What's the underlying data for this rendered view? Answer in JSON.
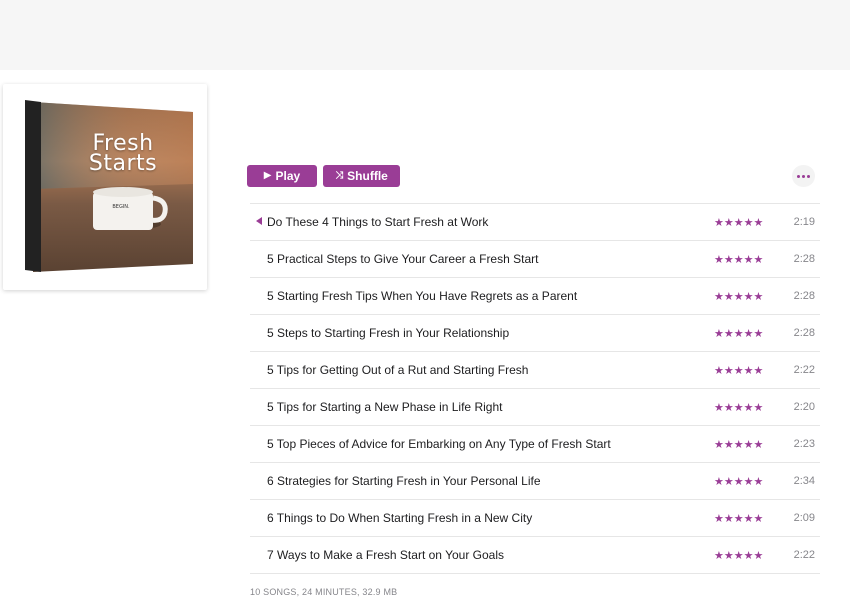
{
  "album": {
    "title": "Fresh\nStarts",
    "mug_text": "BEGIN.",
    "accent": "#9a3d96"
  },
  "controls": {
    "play_label": "Play",
    "play_icon": "play-icon",
    "shuffle_label": "Shuffle",
    "shuffle_icon": "shuffle-icon",
    "more_icon": "ellipsis-icon"
  },
  "tracks": [
    {
      "title": "Do These 4 Things to Start Fresh at Work",
      "rating": "★★★★★",
      "duration": "2:19",
      "now_playing": true
    },
    {
      "title": "5 Practical Steps to Give Your Career a Fresh Start",
      "rating": "★★★★★",
      "duration": "2:28"
    },
    {
      "title": "5 Starting Fresh Tips When You Have Regrets as a Parent",
      "rating": "★★★★★",
      "duration": "2:28"
    },
    {
      "title": "5 Steps to Starting Fresh in Your Relationship",
      "rating": "★★★★★",
      "duration": "2:28"
    },
    {
      "title": "5 Tips for Getting Out of a Rut and Starting Fresh",
      "rating": "★★★★★",
      "duration": "2:22"
    },
    {
      "title": "5 Tips for Starting a New Phase in Life Right",
      "rating": "★★★★★",
      "duration": "2:20"
    },
    {
      "title": "5 Top Pieces of Advice for Embarking on Any Type of Fresh Start",
      "rating": "★★★★★",
      "duration": "2:23"
    },
    {
      "title": "6 Strategies for Starting Fresh in Your Personal Life",
      "rating": "★★★★★",
      "duration": "2:34"
    },
    {
      "title": "6 Things to Do When Starting Fresh in a New City",
      "rating": "★★★★★",
      "duration": "2:09"
    },
    {
      "title": "7 Ways to Make a Fresh Start on Your Goals",
      "rating": "★★★★★",
      "duration": "2:22"
    }
  ],
  "footer": {
    "summary": "10 SONGS, 24 MINUTES, 32.9 MB"
  }
}
